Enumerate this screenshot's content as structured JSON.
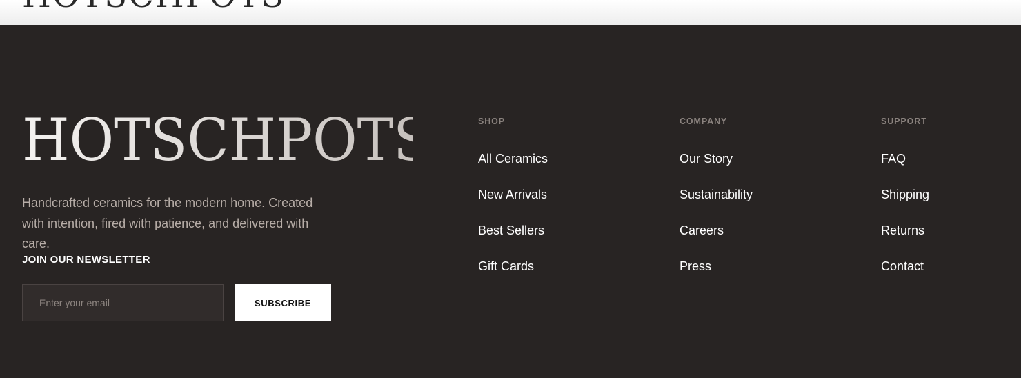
{
  "brand": {
    "name": "HOTSCHPOTS"
  },
  "tagline": "Handcrafted ceramics for the modern home. Created with intention, fired with patience, and delivered with care.",
  "newsletter": {
    "heading": "JOIN OUR NEWSLETTER",
    "email_placeholder": "Enter your email",
    "email_value": "",
    "subscribe_label": "SUBSCRIBE"
  },
  "columns": {
    "shop": {
      "heading": "SHOP",
      "links": [
        "All Ceramics",
        "New Arrivals",
        "Best Sellers",
        "Gift Cards"
      ]
    },
    "company": {
      "heading": "COMPANY",
      "links": [
        "Our Story",
        "Sustainability",
        "Careers",
        "Press"
      ]
    },
    "support": {
      "heading": "SUPPORT",
      "links": [
        "FAQ",
        "Shipping",
        "Returns",
        "Contact"
      ]
    }
  },
  "colors": {
    "footer_background": "#282423",
    "link_text": "#ffffff",
    "column_heading": "#8a827e",
    "tagline_text": "#b7ada7",
    "subscribe_background": "#ffffff"
  }
}
